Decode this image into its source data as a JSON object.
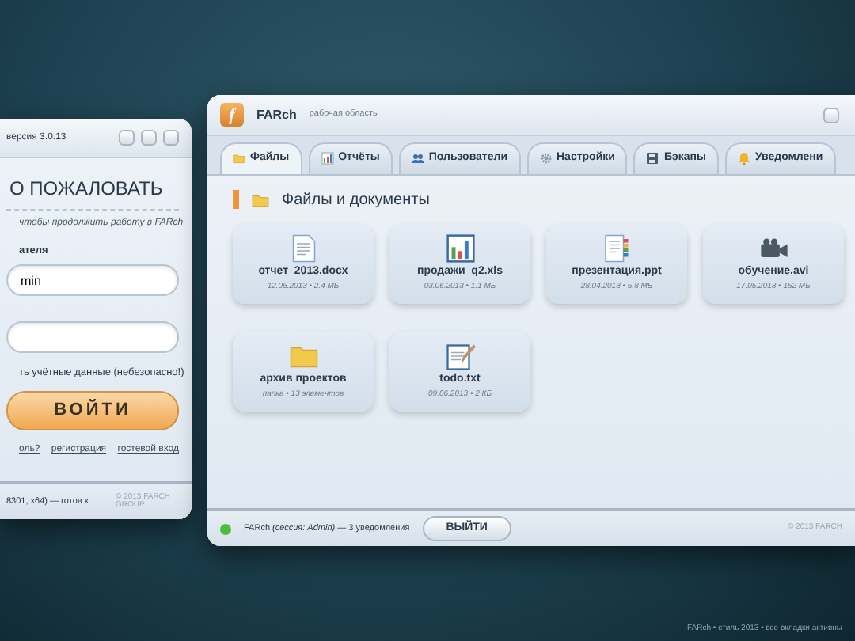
{
  "login_window": {
    "version": "версия 3.0.13",
    "heading": "О ПОЖАЛОВАТЬ",
    "subtitle": "чтобы продолжить работу в FARch",
    "username_label": "ателя",
    "username_value": "min",
    "remember_label": "ть учётные данные (небезопасно!)",
    "login_button": "ВОЙТИ",
    "links": [
      "оль?",
      "регистрация",
      "гостевой вход"
    ],
    "status": "8301, x64) — готов к",
    "copyright": "© 2013 FARCH GROUP"
  },
  "main_window": {
    "logo": "f",
    "app_name": "FARch",
    "subtitle": "рабочая область",
    "tabs": [
      {
        "label": "Файлы",
        "selected": true
      },
      {
        "label": "Отчёты",
        "selected": false
      },
      {
        "label": "Пользователи",
        "selected": false
      },
      {
        "label": "Настройки",
        "selected": false
      },
      {
        "label": "Бэкапы",
        "selected": false
      },
      {
        "label": "Уведомлени",
        "selected": false
      }
    ],
    "section_title": "Файлы и документы",
    "files": [
      {
        "kind": "document",
        "name": "отчет_2013.docx",
        "meta": "12.05.2013 • 2.4 МБ"
      },
      {
        "kind": "spreadsheet",
        "name": "продажи_q2.xls",
        "meta": "03.06.2013 • 1.1 МБ"
      },
      {
        "kind": "presentation",
        "name": "презентация.ppt",
        "meta": "28.04.2013 • 5.8 МБ"
      },
      {
        "kind": "video",
        "name": "обучение.avi",
        "meta": "17.05.2013 • 152 МБ"
      },
      {
        "kind": "folder",
        "name": "архив проектов",
        "meta": "папка • 13 элементов"
      },
      {
        "kind": "note",
        "name": "todo.txt",
        "meta": "09.06.2013 • 2 КБ"
      }
    ],
    "status": {
      "online": true,
      "text": "FARch *(сессия: Admin)* — 3 уведомления",
      "logout_button": "ВЫЙТИ",
      "copyright": "© 2013 FARCH"
    }
  },
  "desktop_footer": "FARch • стиль 2013 • все вкладки активны"
}
